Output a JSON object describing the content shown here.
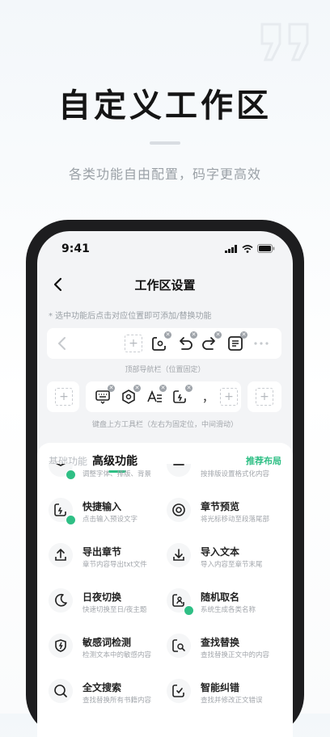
{
  "hero": {
    "title": "自定义工作区",
    "subtitle": "各类功能自由配置，码字更高效"
  },
  "status_bar": {
    "time": "9:41"
  },
  "nav": {
    "title": "工作区设置"
  },
  "hint": "* 选中功能后点击对应位置即可添加/替换功能",
  "top_toolbar_caption": "顶部导航栏（位置固定）",
  "keyboard_toolbar": {
    "comma": "，",
    "caption": "键盘上方工具栏（左右为固定位，中间滑动）"
  },
  "tabs": {
    "basic": "基础功能",
    "advanced": "高级功能",
    "recommend": "推荐布局"
  },
  "features_partial": [
    {
      "desc": "调整字体、排版、背景",
      "checked": true,
      "icon": "chevron-icon"
    },
    {
      "desc": "按排版设置格式化内容",
      "checked": false,
      "icon": "dash-icon"
    }
  ],
  "features": [
    {
      "name": "快捷输入",
      "desc": "点击输入预设文字",
      "checked": true,
      "icon": "quick-input-icon"
    },
    {
      "name": "章节预览",
      "desc": "将光标移动至段落尾部",
      "checked": false,
      "icon": "eye-icon"
    },
    {
      "name": "导出章节",
      "desc": "章节内容导出txt文件",
      "checked": false,
      "icon": "export-icon"
    },
    {
      "name": "导入文本",
      "desc": "导入内容至章节末尾",
      "checked": false,
      "icon": "import-icon"
    },
    {
      "name": "日夜切换",
      "desc": "快速切换至日/夜主题",
      "checked": false,
      "icon": "moon-icon"
    },
    {
      "name": "随机取名",
      "desc": "系统生成各类名称",
      "checked": true,
      "icon": "random-name-icon"
    },
    {
      "name": "敏感词检测",
      "desc": "检测文本中的敏感内容",
      "checked": false,
      "icon": "shield-icon"
    },
    {
      "name": "查找替换",
      "desc": "查找替换正文中的内容",
      "checked": false,
      "icon": "find-replace-icon"
    },
    {
      "name": "全文搜索",
      "desc": "查找替换所有书籍内容",
      "checked": false,
      "icon": "search-icon"
    },
    {
      "name": "智能纠错",
      "desc": "查找并修改正文错误",
      "checked": false,
      "icon": "spell-check-icon"
    }
  ],
  "colors": {
    "accent": "#2fbf85",
    "badge": "#9ea3a9"
  }
}
